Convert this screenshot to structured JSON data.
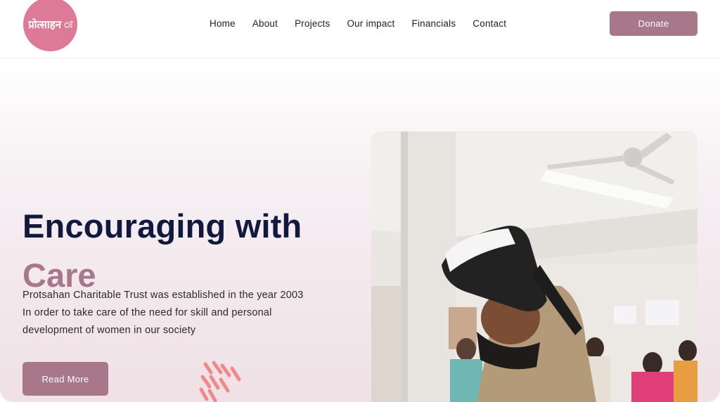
{
  "brand": {
    "logo_text": "प्रोत्साहन ः",
    "accent_color": "#a7778a",
    "logo_color": "#dc7a98"
  },
  "nav": {
    "items": [
      "Home",
      "About",
      "Projects",
      "Our impact",
      "Financials",
      "Contact"
    ],
    "donate_label": "Donate"
  },
  "hero": {
    "title_line1": "Encouraging with",
    "title_line2": "Care",
    "description": "Protsahan Charitable Trust was established in the year 2003 In order to take care of the need for skill and personal development of women in our society",
    "cta_label": "Read More",
    "title_color": "#12193f"
  },
  "photo": {
    "icon": "vr-headset-photo"
  }
}
